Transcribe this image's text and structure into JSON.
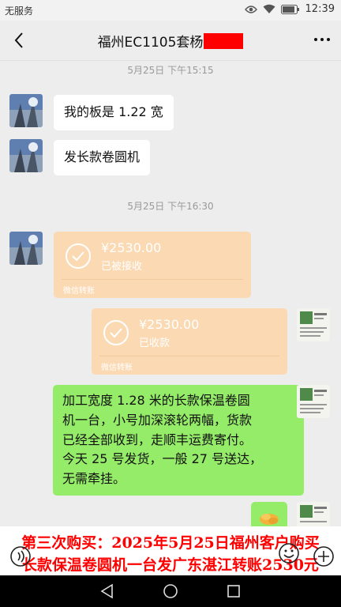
{
  "status_bar": {
    "carrier": "无服务",
    "time": "12:39"
  },
  "header": {
    "title": "福州EC1105套杨"
  },
  "messages": {
    "ts1": "5月25日 下午15:15",
    "m1": "我的板是 1.22 宽",
    "m2": "发长款卷圆机",
    "ts2": "5月25日 下午16:30",
    "transfer_in": {
      "amount": "¥2530.00",
      "status": "已被接收",
      "footer": "微信转账"
    },
    "transfer_out": {
      "amount": "¥2530.00",
      "status": "已收款",
      "footer": "微信转账"
    },
    "m3_lines": [
      "加工宽度 1.28 米的长款保温卷圆",
      "机一台，小号加深滚轮两幅，货款",
      "已经全部收到，走顺丰运费寄付。",
      "今天 25 号发货，一般 27 号送达，",
      "无需牵挂。"
    ]
  },
  "banner": {
    "line1": "第三次购买：2025年5月25日福州客户购买",
    "line2": "长款保温卷圆机一台发广东湛江转账2530元"
  },
  "colors": {
    "sent_bubble": "#95ec69",
    "transfer": "#fbd9b3",
    "banner_text": "#ff0000"
  }
}
